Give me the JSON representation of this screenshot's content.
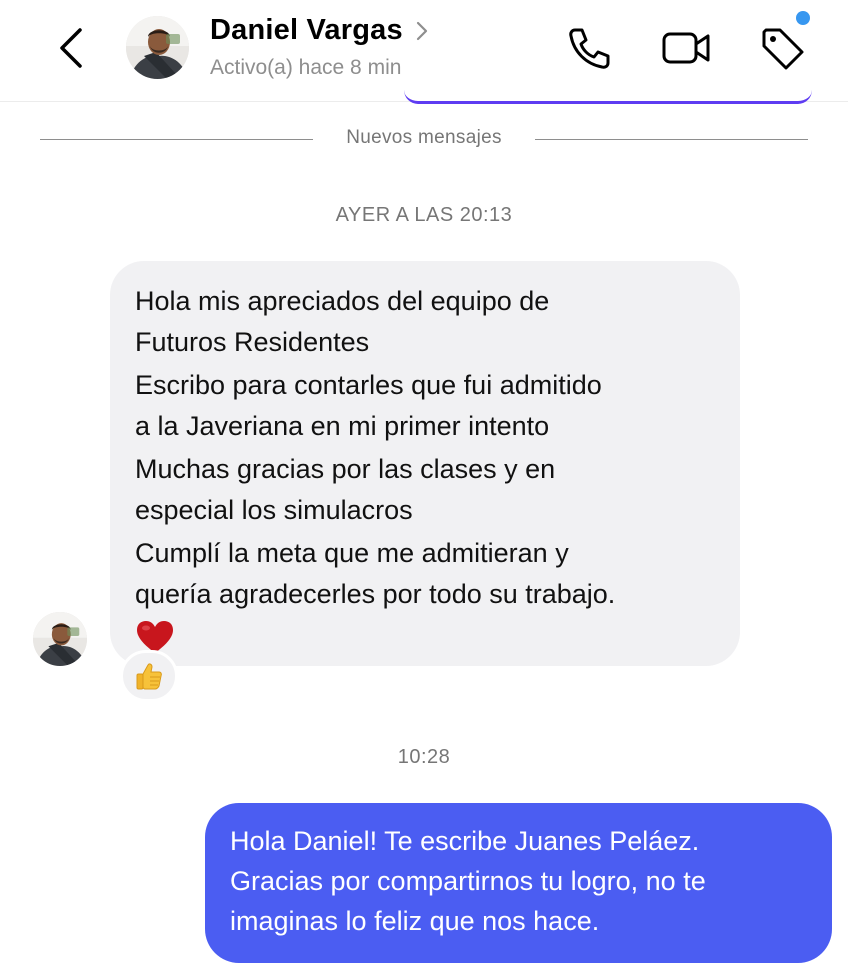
{
  "header": {
    "contact_name": "Daniel Vargas",
    "status": "Activo(a) hace 8 min",
    "icons": {
      "back": "back-chevron-icon",
      "call": "phone-icon",
      "video": "video-camera-icon",
      "tag": "tag-icon"
    },
    "notification_dot_color": "#3797f0"
  },
  "divider_label": "Nuevos mensajes",
  "thread": {
    "timestamp_1": "AYER A LAS 20:13",
    "incoming_lines": [
      "Hola mis apreciados del equipo de",
      "Futuros Residentes",
      "Escribo para contarles que fui admitido",
      "a la Javeriana en mi primer intento",
      "Muchas gracias por las clases y en",
      "especial los simulacros",
      "Cumplí la meta que me admitieran y",
      "quería agradecerles por todo su trabajo."
    ],
    "incoming_emoji": "red-heart-icon",
    "reaction_emoji": "thumbs-up-icon",
    "timestamp_2": "10:28",
    "outgoing_lines": [
      "Hola Daniel! Te escribe Juanes Peláez.",
      "Gracias por compartirnos tu logro, no te",
      "imaginas lo feliz que nos hace."
    ],
    "colors": {
      "incoming_bubble": "#f1f1f3",
      "outgoing_bubble": "#4b5df2",
      "accent_purple": "#5e3cf2"
    }
  }
}
